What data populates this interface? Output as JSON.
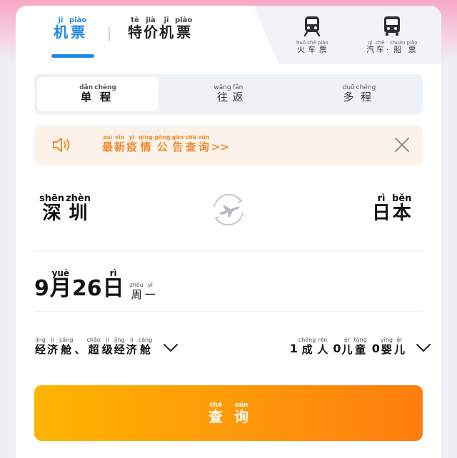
{
  "tabs": {
    "flight": {
      "pinyin": [
        "jī",
        "piào"
      ],
      "hanzi": [
        "机",
        "票"
      ]
    },
    "special": {
      "pinyin": [
        "tè",
        "jià",
        "jī",
        "piào"
      ],
      "hanzi": [
        "特",
        "价",
        "机",
        "票"
      ]
    },
    "train": {
      "pinyin": [
        "huǒ",
        "chē",
        "piào"
      ],
      "hanzi": [
        "火",
        "车",
        "票"
      ]
    },
    "bus": {
      "pinyin": [
        "qì",
        "chē",
        "",
        "chuán",
        "piào"
      ],
      "hanzi": [
        "汽",
        "车",
        "·",
        "船",
        "票"
      ]
    }
  },
  "trip_type": [
    {
      "pinyin": [
        "dān",
        "chéng"
      ],
      "hanzi": [
        "单",
        "程"
      ]
    },
    {
      "pinyin": [
        "wǎng",
        "fǎn"
      ],
      "hanzi": [
        "往",
        "返"
      ]
    },
    {
      "pinyin": [
        "duō",
        "chéng"
      ],
      "hanzi": [
        "多",
        "程"
      ]
    }
  ],
  "notice": {
    "pinyin": [
      "zuì",
      "xīn",
      "yì",
      "qíng",
      "gōng",
      "gào",
      "chá",
      "xún"
    ],
    "hanzi": [
      "最",
      "新",
      "疫",
      "情",
      "公",
      "告",
      "查",
      "询"
    ],
    "suffix": ">>"
  },
  "route": {
    "from": {
      "pinyin": [
        "shēn",
        "zhèn"
      ],
      "hanzi": [
        "深",
        "圳"
      ]
    },
    "to": {
      "pinyin": [
        "rì",
        "běn"
      ],
      "hanzi": [
        "日",
        "本"
      ]
    }
  },
  "date": {
    "month": "9",
    "month_char": {
      "pinyin": "yuè",
      "hanzi": "月"
    },
    "day": "26",
    "day_char": {
      "pinyin": "rì",
      "hanzi": "日"
    },
    "weekday": {
      "pinyin": [
        "zhōu",
        "yī"
      ],
      "hanzi": [
        "周",
        "一"
      ]
    }
  },
  "cabin": {
    "pinyin": [
      "jīng",
      "jì",
      "cāng",
      "",
      "chāo",
      "jí",
      "jīng",
      "jì",
      "cāng"
    ],
    "hanzi": [
      "经",
      "济",
      "舱",
      "、",
      "超",
      "级",
      "经",
      "济",
      "舱"
    ]
  },
  "passengers": {
    "adult_count": "1",
    "adult": {
      "pinyin": [
        "chéng",
        "rén"
      ],
      "hanzi": [
        "成",
        "人"
      ]
    },
    "child_count": "0",
    "child": {
      "pinyin": [
        "ér",
        "tóng"
      ],
      "hanzi": [
        "儿",
        "童"
      ]
    },
    "infant_count": "0",
    "infant": {
      "pinyin": [
        "yīng",
        "ér"
      ],
      "hanzi": [
        "婴",
        "儿"
      ]
    }
  },
  "search": {
    "pinyin": [
      "chá",
      "xún"
    ],
    "hanzi": [
      "查",
      "询"
    ]
  },
  "colors": {
    "accent": "#1e88e5",
    "notice": "#ee8a2e",
    "button_start": "#ffb400",
    "button_end": "#ff7d0e"
  }
}
